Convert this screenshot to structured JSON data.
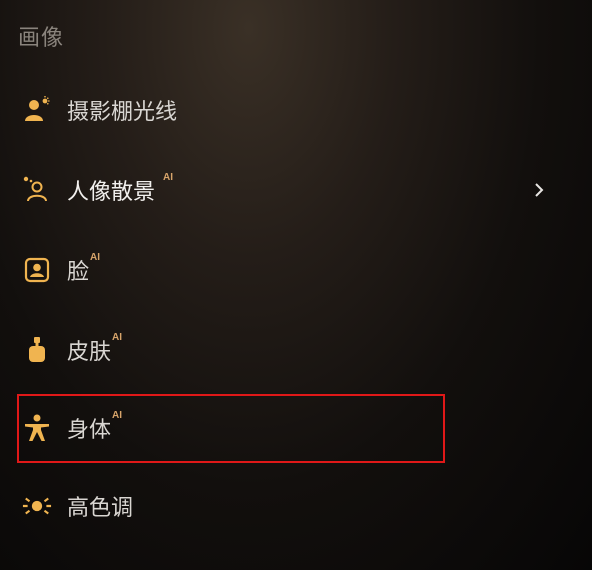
{
  "section": {
    "title": "画像"
  },
  "items": [
    {
      "label": "摄影棚光线",
      "icon": "studio-light-person-icon",
      "badge": ""
    },
    {
      "label": "人像散景",
      "icon": "portrait-bokeh-icon",
      "badge": "AI",
      "has_submenu": true
    },
    {
      "label": "脸",
      "icon": "face-frame-icon",
      "badge": "AI"
    },
    {
      "label": "皮肤",
      "icon": "skin-bottle-icon",
      "badge": "AI"
    },
    {
      "label": "身体",
      "icon": "body-figure-icon",
      "badge": "AI",
      "highlighted": true
    },
    {
      "label": "高色调",
      "icon": "high-key-sun-icon",
      "badge": ""
    }
  ],
  "colors": {
    "accent": "#f0b450",
    "highlight_border": "#e01818",
    "ai_badge": "#d7a46a"
  }
}
